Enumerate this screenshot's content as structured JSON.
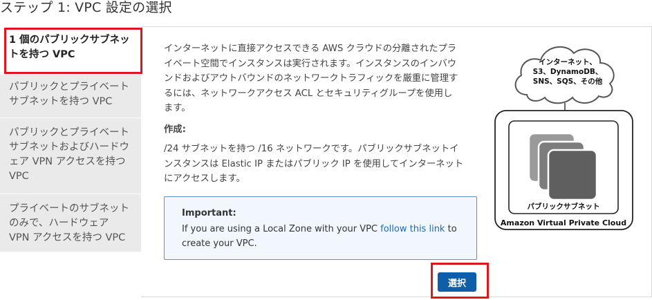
{
  "page": {
    "title": "ステップ 1: VPC 設定の選択"
  },
  "sidebar": {
    "items": [
      {
        "label": "1 個のパブリックサブネットを持つ VPC",
        "lines": [
          "1 個のパブリックサブネッ",
          "トを持つ VPC"
        ],
        "active": true
      },
      {
        "label": "パブリックとプライベートサブネットを持つ VPC",
        "lines": [
          "パブリックとプライベート",
          "サブネットを持つ VPC"
        ],
        "active": false
      },
      {
        "label": "パブリックとプライベートサブネットおよびハードウェア VPN アクセスを持つ VPC",
        "lines": [
          "パブリックとプライベート",
          "サブネットおよびハードウ",
          "ェア VPN アクセスを持つ",
          "VPC"
        ],
        "active": false
      },
      {
        "label": "プライベートのサブネットのみで、ハードウェア VPN アクセスを持つ VPC",
        "lines": [
          "プライベートのサブネット",
          "のみで、ハードウェア",
          "VPN アクセスを持つ VPC"
        ],
        "active": false
      }
    ]
  },
  "main": {
    "description_lines": [
      "インターネットに直接アクセスできる AWS クラウドの分離されたプラ",
      "イベート空間でインスタンスは実行されます。インスタンスのインバウ",
      "ンドおよびアウトバウンドのネットワークトラフィックを厳重に管理す",
      "るには、ネットワークアクセス ACL とセキュリティグループを使用し",
      "ます。"
    ],
    "creates_label": "作成:",
    "creates_lines": [
      "/24 サブネットを持つ /16 ネットワークです。パブリックサブネットイ",
      "ンスタンスは Elastic IP またはパブリック IP を使用してインターネット",
      "にアクセスします。"
    ],
    "notice": {
      "title": "Important:",
      "text_before": "If you are using a Local Zone with your VPC ",
      "link": "follow this link",
      "text_after": " to create your VPC."
    },
    "select_button": "選択"
  },
  "diagram": {
    "cloud_lines": [
      "インターネット、",
      "S3、DynamoDB、",
      "SNS、SQS、その他"
    ],
    "subnet_label": "パブリックサブネット",
    "vpc_label": "Amazon Virtual Private Cloud"
  },
  "colors": {
    "highlight": "#e4141e",
    "button": "#0f5fa8",
    "link": "#1f69b3",
    "notice_border": "#5b93c9",
    "sidebar_bg": "#eaeaea"
  }
}
